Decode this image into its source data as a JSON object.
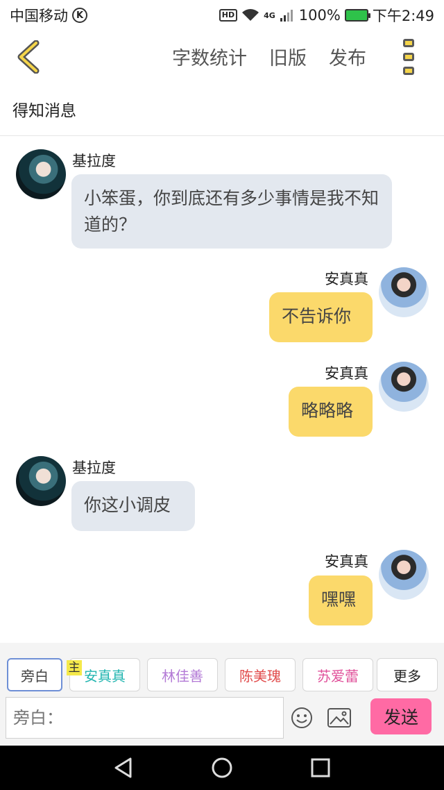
{
  "status_bar": {
    "carrier": "中国移动",
    "carrier_badge": "K",
    "hd": "HD",
    "network": "4G",
    "battery": "100%",
    "time": "下午2:49"
  },
  "toolbar": {
    "menu": [
      "字数统计",
      "旧版",
      "发布"
    ]
  },
  "chapter": {
    "title": "得知消息"
  },
  "messages": [
    {
      "name": "基拉度",
      "text": "小笨蛋，你到底还有多少事情是我不知道的？",
      "side": "left"
    },
    {
      "name": "安真真",
      "text": "不告诉你",
      "side": "right"
    },
    {
      "name": "安真真",
      "text": "略略略",
      "side": "right"
    },
    {
      "name": "基拉度",
      "text": "你这小调皮",
      "side": "left"
    },
    {
      "name": "安真真",
      "text": "嘿嘿",
      "side": "right"
    }
  ],
  "roles": [
    {
      "label": "旁白",
      "color": "#444444"
    },
    {
      "label": "安真真",
      "color": "#22b5b0"
    },
    {
      "label": "林佳善",
      "color": "#b37ad6"
    },
    {
      "label": "陈美瑰",
      "color": "#e14c4c"
    },
    {
      "label": "苏爱蕾",
      "color": "#e0509a"
    },
    {
      "label": "更多",
      "color": "#444444"
    }
  ],
  "main_role_mark": "主",
  "input": {
    "placeholder": "旁白："
  },
  "send_label": "发送",
  "icons": [
    "back-icon",
    "more-icon",
    "emoji-icon",
    "image-icon",
    "nav-back-icon",
    "nav-home-icon",
    "nav-recents-icon"
  ]
}
